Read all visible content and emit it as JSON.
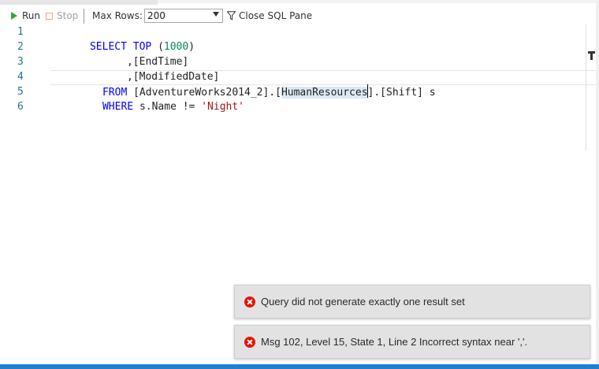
{
  "toolbar": {
    "run_label": "Run",
    "stop_label": "Stop",
    "max_rows_label": "Max Rows:",
    "max_rows_value": "200",
    "close_sql_label": "Close SQL Pane"
  },
  "editor": {
    "lines": [
      {
        "number": "1",
        "segments": [
          {
            "cls": "kw",
            "text": "SELECT TOP "
          },
          {
            "cls": "txt",
            "text": "("
          },
          {
            "cls": "num",
            "text": "1000"
          },
          {
            "cls": "txt",
            "text": ")"
          }
        ]
      },
      {
        "number": "2",
        "segments": [
          {
            "cls": "txt",
            "text": ",[EndTime]"
          }
        ]
      },
      {
        "number": "3",
        "segments": [
          {
            "cls": "txt",
            "text": ",[ModifiedDate]"
          }
        ]
      },
      {
        "number": "4",
        "segments": [
          {
            "cls": "kw",
            "text": "FROM "
          },
          {
            "cls": "txt",
            "text": "[AdventureWorks2014_2].["
          },
          {
            "cls": "txt hl",
            "text": "HumanResources"
          },
          {
            "cls": "txt",
            "text": "].[Shift] s"
          }
        ]
      },
      {
        "number": "5",
        "segments": [
          {
            "cls": "kw",
            "text": "WHERE "
          },
          {
            "cls": "txt",
            "text": "s.Name != "
          },
          {
            "cls": "str",
            "text": "'Night'"
          }
        ]
      },
      {
        "number": "6",
        "segments": []
      }
    ]
  },
  "notifications": [
    {
      "message": "Query did not generate exactly one result set"
    },
    {
      "message": "Msg 102, Level 15, State 1, Line 2 Incorrect syntax near ','."
    }
  ],
  "colors": {
    "keyword": "#0000ff",
    "line_number": "#237893",
    "string": "#a31515",
    "number": "#09885a",
    "error": "#e51400",
    "status_bar": "#1f7fd1"
  }
}
